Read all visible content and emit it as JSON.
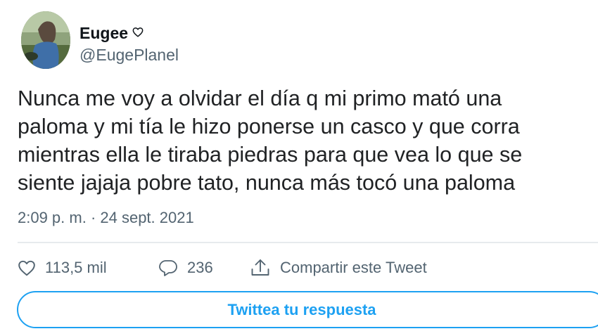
{
  "author": {
    "name": "Eugee",
    "handle": "@EugePlanel",
    "badge_icon": "heart-outline-icon"
  },
  "tweet": {
    "lines": [
      "Nunca me voy a olvidar el día q mi primo mató una",
      "paloma y mi tía le hizo ponerse un casco y que corra",
      "mientras ella le tiraba piedras para que vea lo que se",
      "siente jajaja pobre tato, nunca más tocó una paloma"
    ],
    "timestamp": "2:09 p. m. · 24 sept. 2021"
  },
  "actions": {
    "likes": "113,5 mil",
    "replies": "236",
    "share_label": "Compartir este Tweet"
  },
  "reply_button_label": "Twittea tu respuesta",
  "colors": {
    "accent": "#1da1f2",
    "secondary_text": "#536471",
    "divider": "#e7eaed"
  }
}
